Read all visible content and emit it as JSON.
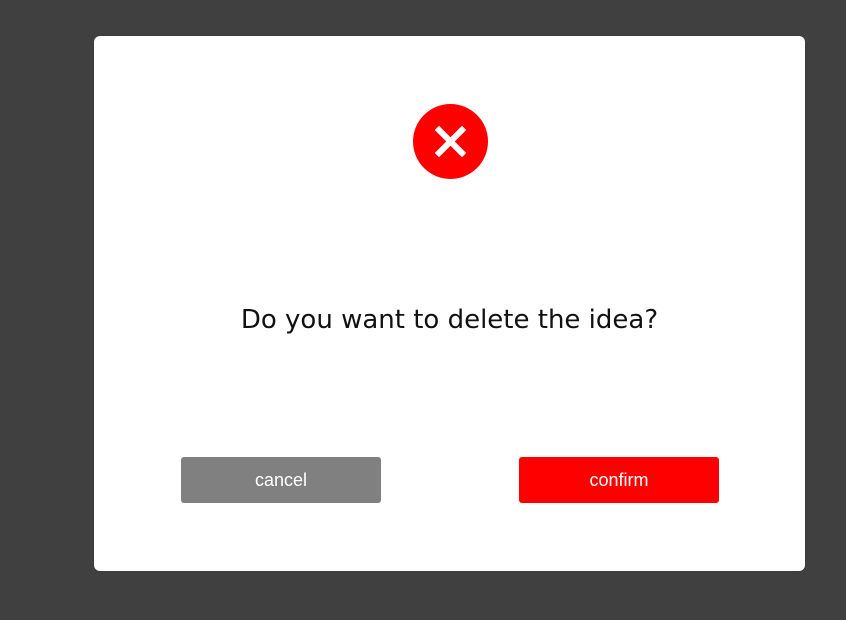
{
  "dialog": {
    "icon": "error-x-icon",
    "message": "Do you want to delete the idea?",
    "cancel_label": "cancel",
    "confirm_label": "confirm"
  },
  "colors": {
    "backdrop": "#404040",
    "dialog_bg": "#ffffff",
    "error_icon": "#ff0000",
    "cancel_button": "#808080",
    "confirm_button": "#ff0000",
    "button_text": "#ffffff"
  }
}
